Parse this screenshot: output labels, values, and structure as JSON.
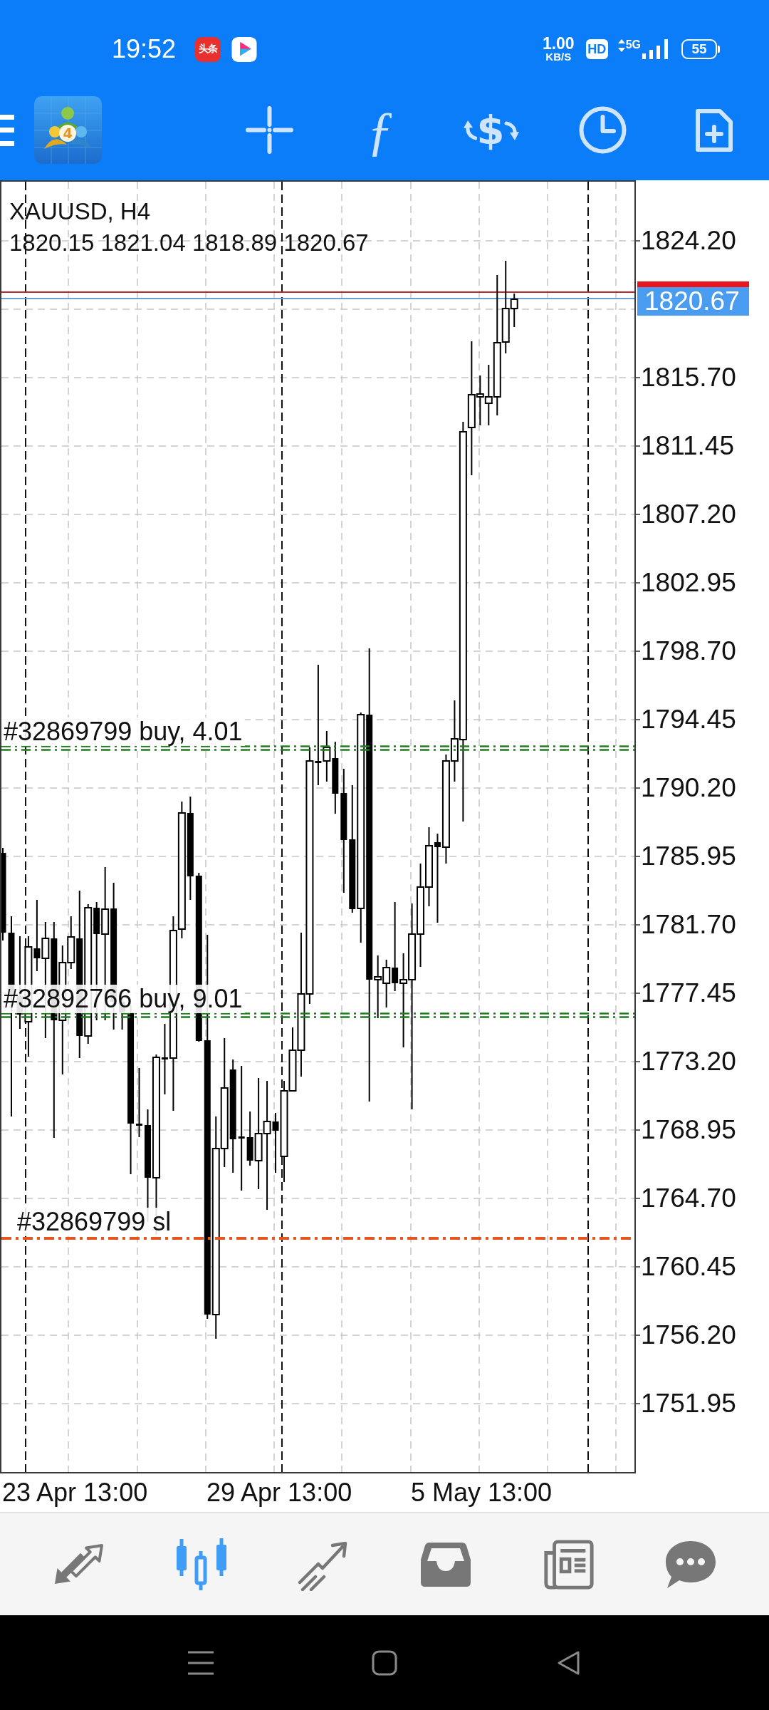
{
  "status_bar": {
    "time": "19:52",
    "app_icons": [
      {
        "kind": "toutiao",
        "label": "头条"
      },
      {
        "kind": "youku"
      }
    ],
    "network_speed": "1.00",
    "network_speed_unit": "KB/S",
    "hd_badge": "HD",
    "network_type": "5G",
    "battery": "55"
  },
  "toolbar": {
    "logo_badge": "4",
    "items": [
      {
        "kind": "crosshair"
      },
      {
        "kind": "indicators",
        "glyph": "ƒ"
      },
      {
        "kind": "trade",
        "glyph": "$"
      },
      {
        "kind": "timeframe"
      },
      {
        "kind": "new_order"
      }
    ]
  },
  "chart": {
    "symbol": "XAUUSD, H4",
    "ohlc": "1820.15 1821.04 1818.89 1820.67",
    "price_axis": [
      {
        "kind": "tick",
        "text": "1824.20"
      },
      {
        "kind": "bid",
        "text": "1820.67"
      },
      {
        "kind": "tick",
        "text": "1815.70"
      },
      {
        "kind": "tick",
        "text": "1811.45"
      },
      {
        "kind": "tick",
        "text": "1807.20"
      },
      {
        "kind": "tick",
        "text": "1802.95"
      },
      {
        "kind": "tick",
        "text": "1798.70"
      },
      {
        "kind": "tick",
        "text": "1794.45"
      },
      {
        "kind": "tick",
        "text": "1790.20"
      },
      {
        "kind": "tick",
        "text": "1785.95"
      },
      {
        "kind": "tick",
        "text": "1781.70"
      },
      {
        "kind": "tick",
        "text": "1777.45"
      },
      {
        "kind": "tick",
        "text": "1773.20"
      },
      {
        "kind": "tick",
        "text": "1768.95"
      },
      {
        "kind": "tick",
        "text": "1764.70"
      },
      {
        "kind": "tick",
        "text": "1760.45"
      },
      {
        "kind": "tick",
        "text": "1756.20"
      },
      {
        "kind": "tick",
        "text": "1751.95"
      }
    ],
    "orders": [
      {
        "kind": "buy",
        "label": "#32869799 buy, 4.01"
      },
      {
        "kind": "buy",
        "label": "#32892766 buy, 9.01"
      },
      {
        "kind": "sl",
        "label": "#32869799 sl"
      }
    ],
    "time_axis": [
      "23 Apr 13:00",
      "29 Apr 13:00",
      "5 May 13:00"
    ]
  },
  "bottom_nav": [
    {
      "kind": "quotes",
      "selected": false
    },
    {
      "kind": "chart",
      "selected": true
    },
    {
      "kind": "trade",
      "selected": false
    },
    {
      "kind": "history",
      "selected": false
    },
    {
      "kind": "news",
      "selected": false
    },
    {
      "kind": "messages",
      "selected": false
    }
  ],
  "system_nav": [
    {
      "kind": "menu"
    },
    {
      "kind": "home"
    },
    {
      "kind": "back"
    }
  ]
}
